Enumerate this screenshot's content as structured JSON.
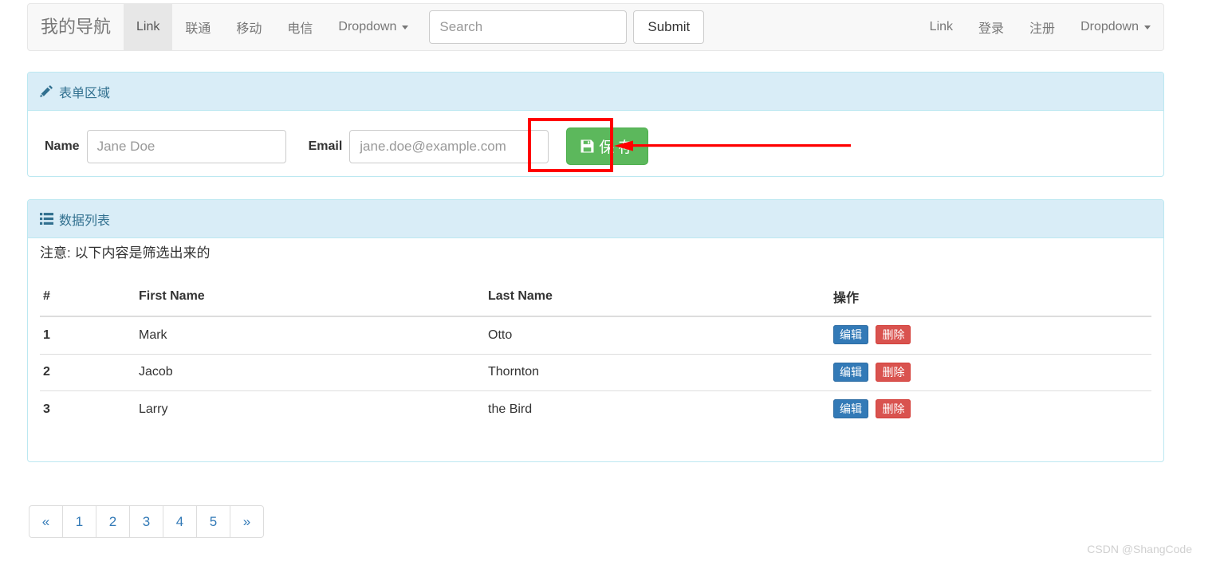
{
  "navbar": {
    "brand": "我的导航",
    "left_items": [
      {
        "label": "Link",
        "active": true,
        "caret": false
      },
      {
        "label": "联通",
        "active": false,
        "caret": false
      },
      {
        "label": "移动",
        "active": false,
        "caret": false
      },
      {
        "label": "电信",
        "active": false,
        "caret": false
      },
      {
        "label": "Dropdown",
        "active": false,
        "caret": true
      }
    ],
    "search": {
      "value": "",
      "placeholder": "Search"
    },
    "submit_label": "Submit",
    "right_items": [
      {
        "label": "Link",
        "caret": false
      },
      {
        "label": "登录",
        "caret": false
      },
      {
        "label": "注册",
        "caret": false
      },
      {
        "label": "Dropdown",
        "caret": true
      }
    ]
  },
  "form_panel": {
    "icon": "pencil-icon",
    "title": "表单区域",
    "name_label": "Name",
    "name_value": "",
    "name_placeholder": "Jane Doe",
    "email_label": "Email",
    "email_value": "",
    "email_placeholder": "jane.doe@example.com",
    "save_icon": "floppy-disk-icon",
    "save_label": "保 存"
  },
  "list_panel": {
    "icon": "th-list-icon",
    "title": "数据列表",
    "note": "注意: 以下内容是筛选出来的",
    "columns": [
      "#",
      "First Name",
      "Last Name",
      "操作"
    ],
    "rows": [
      {
        "index": "1",
        "first_name": "Mark",
        "last_name": "Otto",
        "edit": "编辑",
        "delete": "删除"
      },
      {
        "index": "2",
        "first_name": "Jacob",
        "last_name": "Thornton",
        "edit": "编辑",
        "delete": "删除"
      },
      {
        "index": "3",
        "first_name": "Larry",
        "last_name": "the Bird",
        "edit": "编辑",
        "delete": "删除"
      }
    ]
  },
  "pagination": {
    "items": [
      "«",
      "1",
      "2",
      "3",
      "4",
      "5",
      "»"
    ]
  },
  "annotation": {
    "highlight_color": "#ff0000",
    "target": "save-button"
  },
  "watermark": "CSDN @ShangCode",
  "colors": {
    "navbar_bg": "#f8f8f8",
    "panel_heading_bg": "#d9edf7",
    "panel_border": "#bce8f1",
    "panel_heading_text": "#31708f",
    "save_green": "#5cb85c",
    "edit_blue": "#337ab7",
    "delete_red": "#d9534f",
    "link_blue": "#337ab7"
  }
}
